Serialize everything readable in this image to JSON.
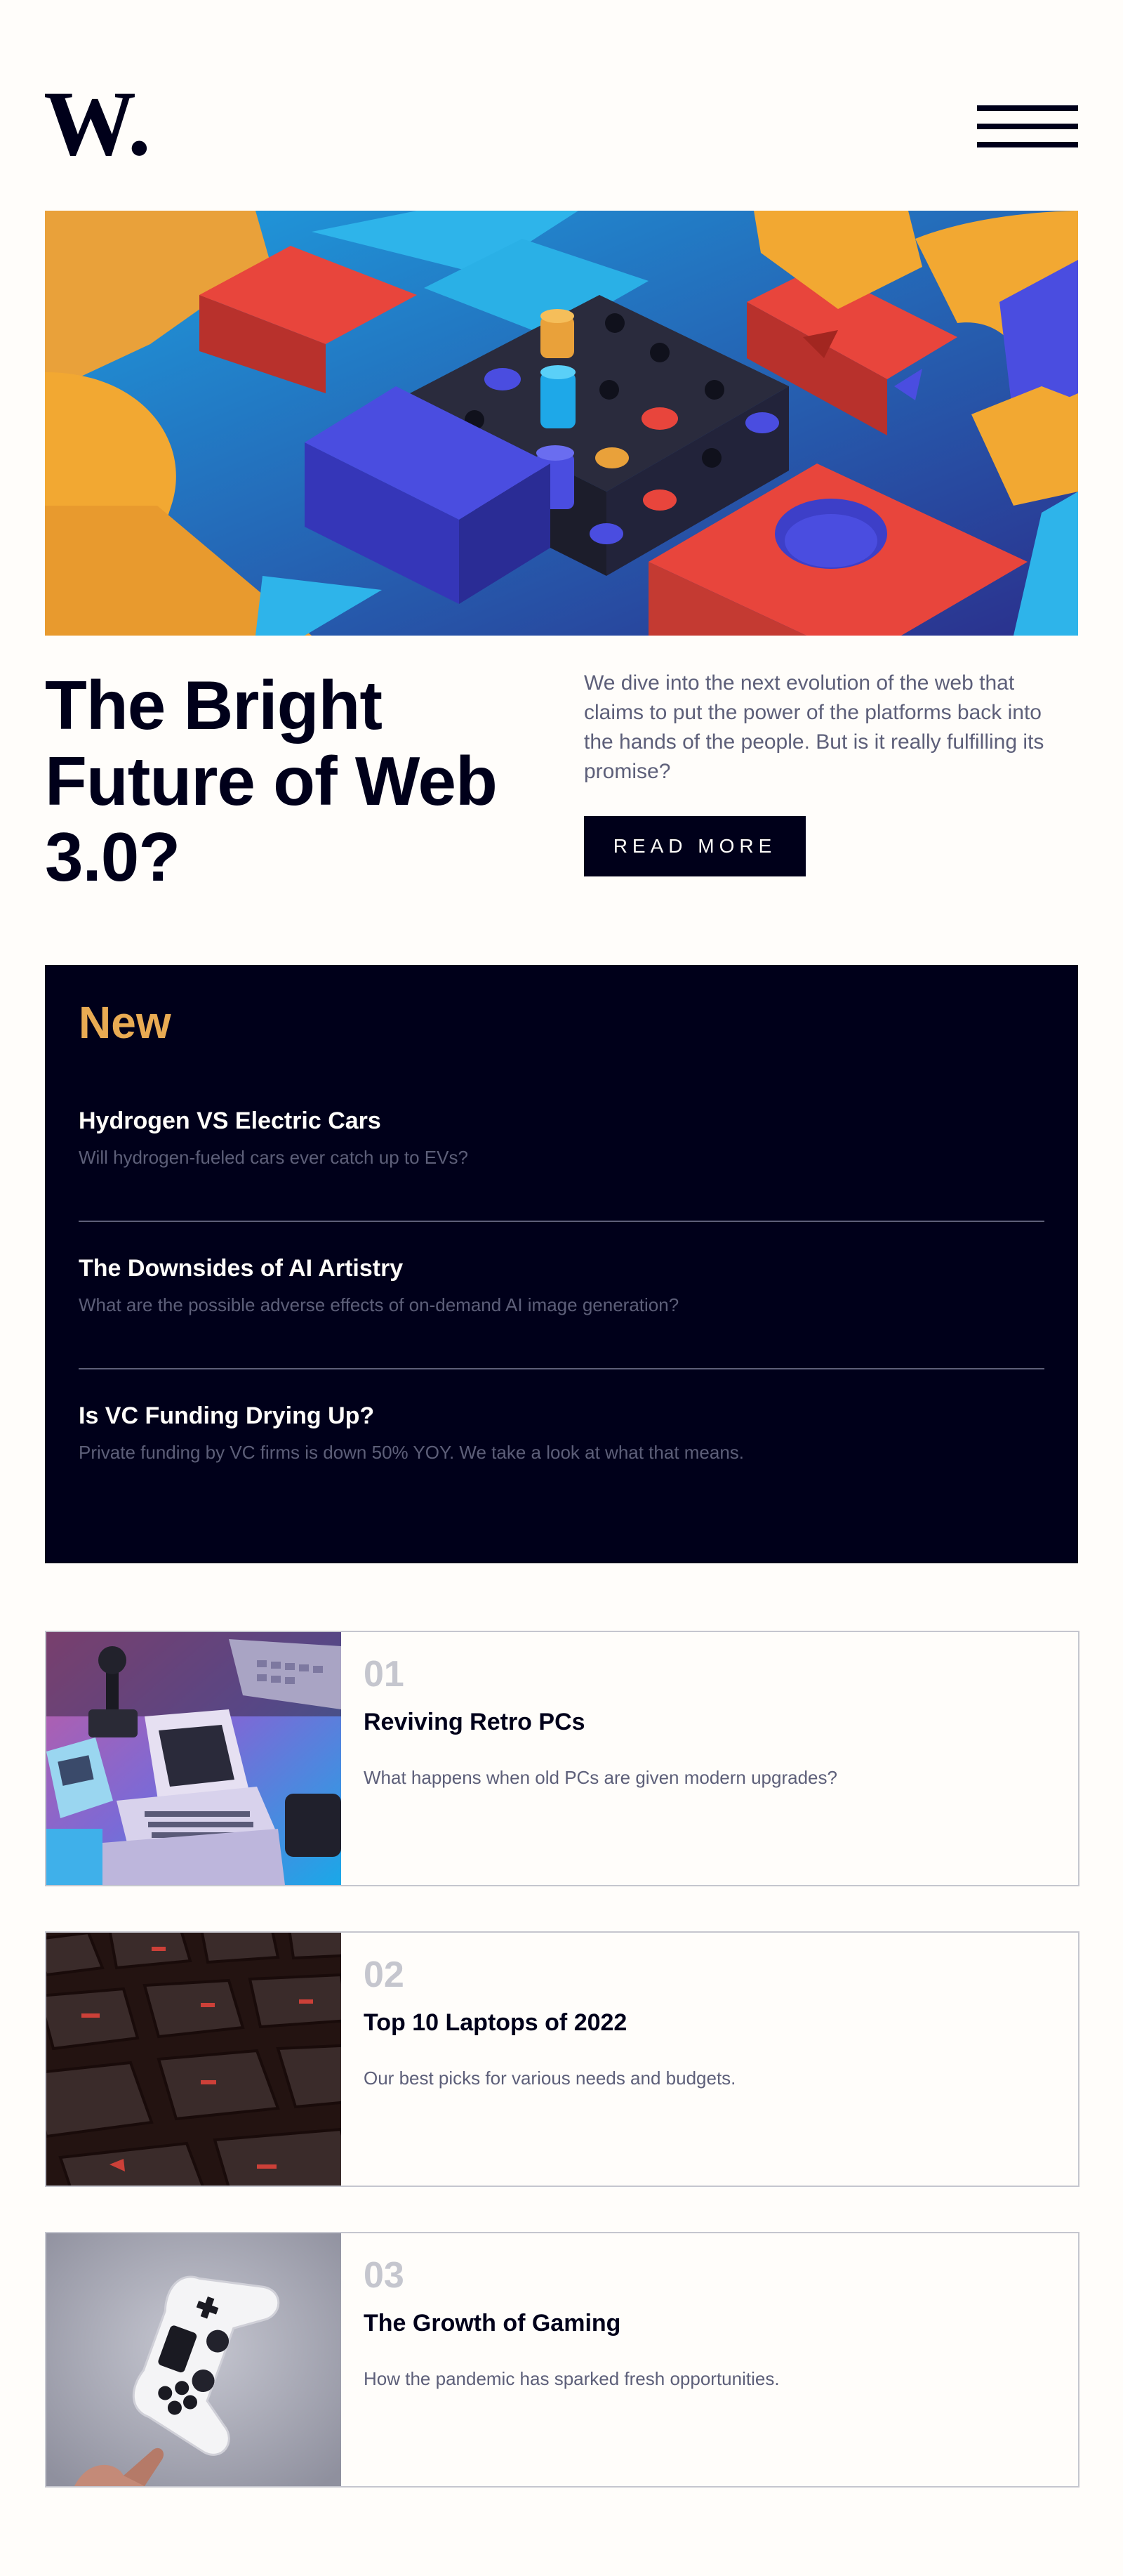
{
  "colors": {
    "background": "#fffdfa",
    "dark_navy": "#00001a",
    "accent_orange": "#e9ab53",
    "grayish_blue": "#5d5f79",
    "light_gray": "#c5c6ce"
  },
  "header": {
    "logo_text": "W.",
    "menu_icon": "hamburger-menu-icon"
  },
  "hero": {
    "image": "colorful-3d-geometric-blocks-image",
    "title": "The Bright Future of Web 3.0?",
    "description": "We dive into the next evolution of the web that claims to put the power of the platforms back into the hands of the people. But is it really fulfilling its promise?",
    "button_label": "READ MORE"
  },
  "new_section": {
    "heading": "New",
    "items": [
      {
        "title": "Hydrogen VS Electric Cars",
        "description": "Will hydrogen-fueled cars ever catch up to EVs?"
      },
      {
        "title": "The Downsides of AI Artistry",
        "description": "What are the possible adverse effects of on-demand AI image generation?"
      },
      {
        "title": "Is VC Funding Drying Up?",
        "description": "Private funding by VC firms is down 50% YOY. We take a look at what that means."
      }
    ]
  },
  "articles": [
    {
      "number": "01",
      "title": "Reviving Retro PCs",
      "description": "What happens when old PCs are given modern upgrades?",
      "image": "retro-pc-image"
    },
    {
      "number": "02",
      "title": "Top 10 Laptops of 2022",
      "description": "Our best picks for various needs and budgets.",
      "image": "laptop-keyboard-image"
    },
    {
      "number": "03",
      "title": "The Growth of Gaming",
      "description": "How the pandemic has sparked fresh opportunities.",
      "image": "game-controller-image"
    }
  ]
}
